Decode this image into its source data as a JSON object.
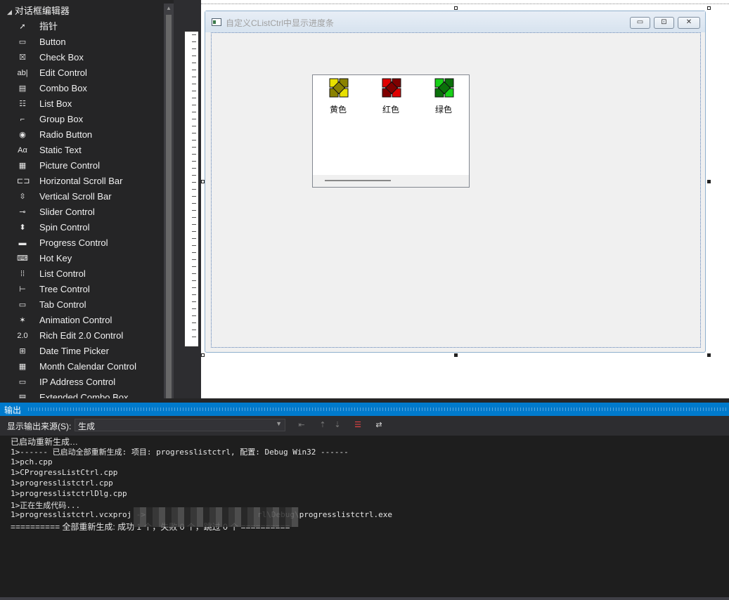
{
  "toolbox": {
    "category": "对话框编辑器",
    "items": [
      {
        "label": "指针",
        "icon": "pointer-icon"
      },
      {
        "label": "Button",
        "icon": "button-icon"
      },
      {
        "label": "Check Box",
        "icon": "checkbox-icon"
      },
      {
        "label": "Edit Control",
        "icon": "edit-control-icon"
      },
      {
        "label": "Combo Box",
        "icon": "combobox-icon"
      },
      {
        "label": "List Box",
        "icon": "listbox-icon"
      },
      {
        "label": "Group Box",
        "icon": "groupbox-icon"
      },
      {
        "label": "Radio Button",
        "icon": "radio-icon"
      },
      {
        "label": "Static Text",
        "icon": "static-text-icon"
      },
      {
        "label": "Picture Control",
        "icon": "picture-icon"
      },
      {
        "label": "Horizontal Scroll Bar",
        "icon": "hscroll-icon"
      },
      {
        "label": "Vertical Scroll Bar",
        "icon": "vscroll-icon"
      },
      {
        "label": "Slider Control",
        "icon": "slider-icon"
      },
      {
        "label": "Spin Control",
        "icon": "spin-icon"
      },
      {
        "label": "Progress Control",
        "icon": "progress-icon"
      },
      {
        "label": "Hot Key",
        "icon": "hotkey-icon"
      },
      {
        "label": "List Control",
        "icon": "listctrl-icon"
      },
      {
        "label": "Tree Control",
        "icon": "tree-icon"
      },
      {
        "label": "Tab Control",
        "icon": "tab-icon"
      },
      {
        "label": "Animation Control",
        "icon": "animation-icon"
      },
      {
        "label": "Rich Edit 2.0 Control",
        "icon": "richedit-icon"
      },
      {
        "label": "Date Time Picker",
        "icon": "datetime-icon"
      },
      {
        "label": "Month Calendar Control",
        "icon": "calendar-icon"
      },
      {
        "label": "IP Address Control",
        "icon": "ipaddress-icon"
      },
      {
        "label": "Extended Combo Box",
        "icon": "extcombo-icon"
      }
    ]
  },
  "dialog": {
    "title": "自定义CListCtrl中显示进度条",
    "items": [
      {
        "label": "黄色",
        "color": "#e8e000",
        "dark": "#8a8200"
      },
      {
        "label": "红色",
        "color": "#e00000",
        "dark": "#800000"
      },
      {
        "label": "绿色",
        "color": "#18d018",
        "dark": "#0a700a"
      }
    ]
  },
  "output": {
    "title": "输出",
    "source_label": "显示输出来源(S):",
    "source_value": "生成",
    "lines": [
      "已启动重新生成…",
      "1>------ 已启动全部重新生成: 项目: progresslistctrl, 配置: Debug Win32 ------",
      "1>pch.cpp",
      "1>CProgressListCtrl.cpp",
      "1>progresslistctrl.cpp",
      "1>progresslistctrlDlg.cpp",
      "1>正在生成代码...",
      "1>progresslistctrl.vcxproj ->                        rl\\Debug\\progresslistctrl.exe",
      "========== 全部重新生成: 成功 1 个，失败 0 个，跳过 0 个 =========="
    ]
  }
}
